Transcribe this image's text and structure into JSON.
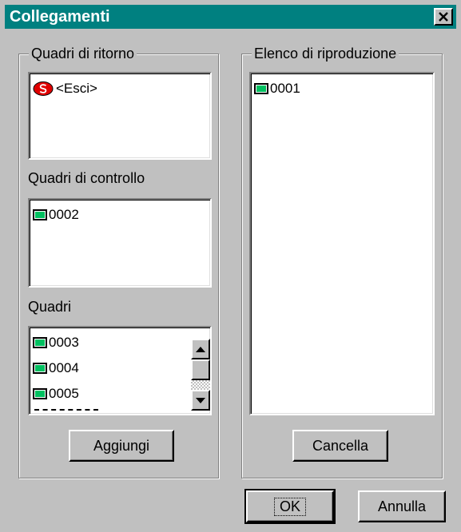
{
  "window": {
    "title": "Collegamenti"
  },
  "return_frames": {
    "label": "Quadri di ritorno",
    "items": [
      {
        "label": "<Esci>",
        "icon": "stop-icon"
      }
    ]
  },
  "control_frames": {
    "label": "Quadri di controllo",
    "items": [
      {
        "label": "0002",
        "icon": "frame-icon"
      }
    ]
  },
  "frames": {
    "label": "Quadri",
    "items": [
      {
        "label": "0003",
        "icon": "frame-icon"
      },
      {
        "label": "0004",
        "icon": "frame-icon"
      },
      {
        "label": "0005",
        "icon": "frame-icon"
      }
    ],
    "add_button": "Aggiungi"
  },
  "playlist": {
    "label": "Elenco di riproduzione",
    "items": [
      {
        "label": "0001",
        "icon": "frame-icon"
      }
    ],
    "delete_button": "Cancella"
  },
  "buttons": {
    "ok": "OK",
    "cancel": "Annulla"
  },
  "colors": {
    "titlebar": "#008080",
    "face": "#c0c0c0",
    "frame_icon": "#00c060",
    "stop_icon": "#e00000"
  }
}
